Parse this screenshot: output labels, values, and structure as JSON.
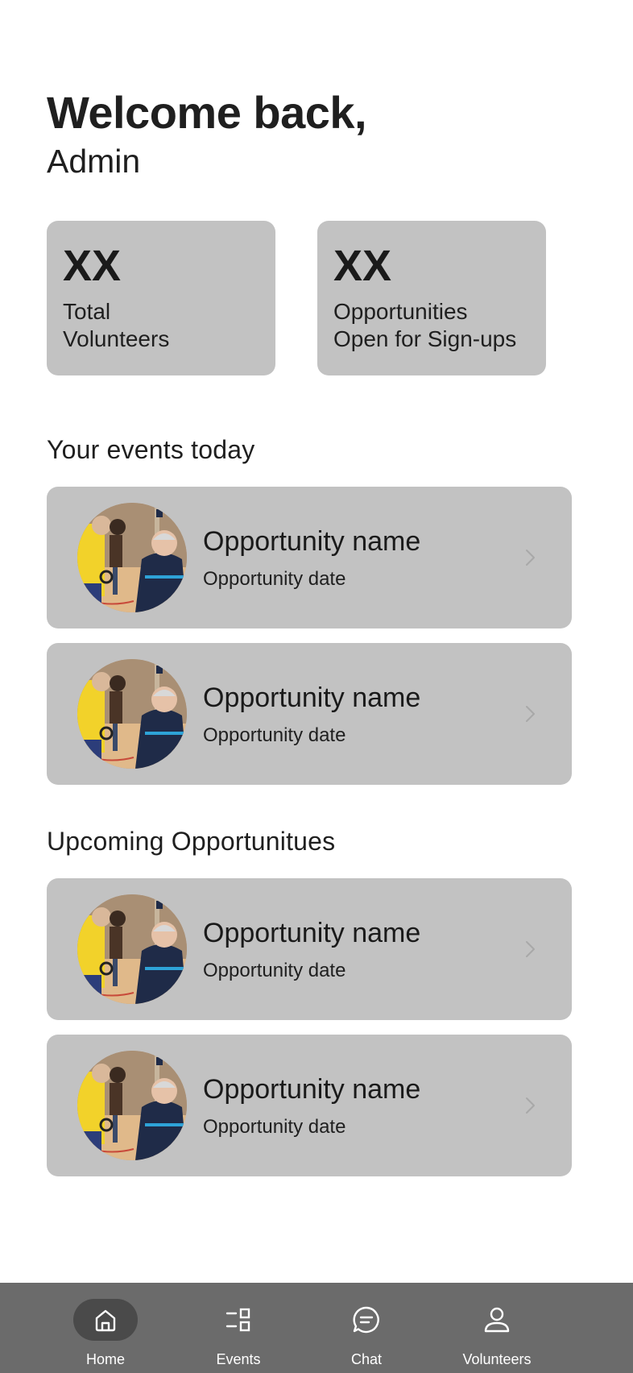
{
  "greeting": {
    "title": "Welcome back,",
    "name": "Admin"
  },
  "stats": [
    {
      "value": "XX",
      "label": "Total\nVolunteers"
    },
    {
      "value": "XX",
      "label": "Opportunities\nOpen for Sign-ups"
    }
  ],
  "sections": {
    "today_title": "Your events today",
    "upcoming_title": "Upcoming Opportunitues"
  },
  "today_events": [
    {
      "name": "Opportunity name",
      "date": "Opportunity date"
    },
    {
      "name": "Opportunity name",
      "date": "Opportunity date"
    }
  ],
  "upcoming_events": [
    {
      "name": "Opportunity name",
      "date": "Opportunity date"
    },
    {
      "name": "Opportunity name",
      "date": "Opportunity date"
    }
  ],
  "nav": {
    "items": [
      {
        "label": "Home",
        "icon": "home-icon",
        "active": true
      },
      {
        "label": "Events",
        "icon": "events-icon",
        "active": false
      },
      {
        "label": "Chat",
        "icon": "chat-icon",
        "active": false
      },
      {
        "label": "Volunteers",
        "icon": "person-icon",
        "active": false
      }
    ]
  },
  "colors": {
    "card_bg": "#c2c2c2",
    "nav_bg": "#6b6b6b",
    "nav_active": "#4a4a4a"
  }
}
